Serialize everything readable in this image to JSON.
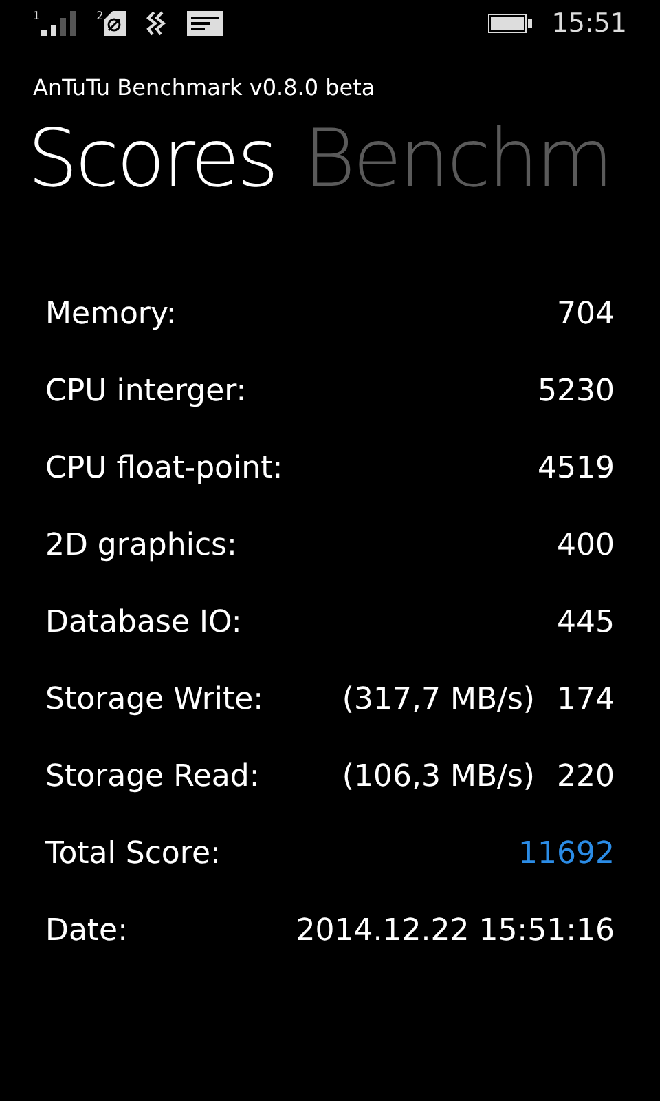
{
  "status_bar": {
    "sim_1": "1",
    "sim_2": "2",
    "time": "15:51"
  },
  "app_title": "AnTuTu Benchmark v0.8.0 beta",
  "pivot": [
    {
      "label": "Scores",
      "selected": true
    },
    {
      "label": "Benchm",
      "selected": false
    }
  ],
  "rows": [
    {
      "label": "Memory:",
      "value": "704"
    },
    {
      "label": "CPU interger:",
      "value": "5230"
    },
    {
      "label": "CPU float-point:",
      "value": "4519"
    },
    {
      "label": "2D graphics:",
      "value": "400"
    },
    {
      "label": "Database IO:",
      "value": "445"
    },
    {
      "label": "Storage Write:",
      "speed": "(317,7 MB/s)",
      "value": "174"
    },
    {
      "label": "Storage Read:",
      "speed": "(106,3 MB/s)",
      "value": "220"
    },
    {
      "label": "Total Score:",
      "value": "11692",
      "color": "#2b8ce6"
    },
    {
      "label": "Date:",
      "value": "2014.12.22 15:51:16"
    }
  ]
}
